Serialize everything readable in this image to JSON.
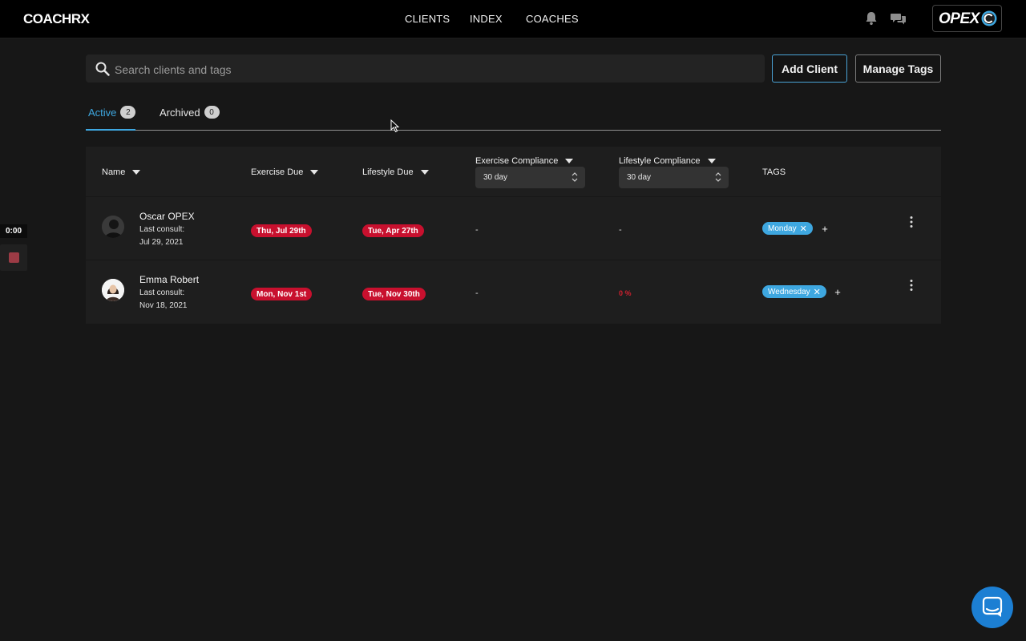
{
  "app": {
    "logo": "COACHRX",
    "brand": "OPEX"
  },
  "nav": [
    {
      "label": "CLIENTS"
    },
    {
      "label": "INDEX"
    },
    {
      "label": "COACHES"
    }
  ],
  "header_icons": [
    "bell-icon",
    "chat-bubbles-icon"
  ],
  "search": {
    "placeholder": "Search clients and tags",
    "value": ""
  },
  "actions": {
    "add_client": "Add Client",
    "manage_tags": "Manage Tags"
  },
  "tabs": [
    {
      "label": "Active",
      "count": "2",
      "active": true
    },
    {
      "label": "Archived",
      "count": "0",
      "active": false
    }
  ],
  "columns": {
    "name": "Name",
    "exercise_due": "Exercise Due",
    "lifestyle_due": "Lifestyle Due",
    "exercise_compliance": "Exercise Compliance",
    "lifestyle_compliance": "Lifestyle Compliance",
    "tags": "TAGS",
    "exercise_compliance_period": "30 day",
    "lifestyle_compliance_period": "30 day"
  },
  "clients": [
    {
      "name": "Oscar OPEX",
      "last_consult_label": "Last consult:",
      "last_consult_date": "Jul 29, 2021",
      "exercise_due": "Thu, Jul 29th",
      "lifestyle_due": "Tue, Apr 27th",
      "exercise_compliance": "-",
      "lifestyle_compliance": "-",
      "tag": "Monday",
      "tag_add": "+"
    },
    {
      "name": "Emma Robert",
      "last_consult_label": "Last consult:",
      "last_consult_date": "Nov 18, 2021",
      "exercise_due": "Mon, Nov 1st",
      "lifestyle_due": "Tue, Nov 30th",
      "exercise_compliance": "-",
      "lifestyle_compliance": "0 %",
      "tag": "Wednesday",
      "tag_add": "+"
    }
  ],
  "recorder": {
    "time": "0:00"
  },
  "colors": {
    "accent": "#3ea7e0",
    "overdue": "#c8102e",
    "chat": "#1c7fd3"
  }
}
